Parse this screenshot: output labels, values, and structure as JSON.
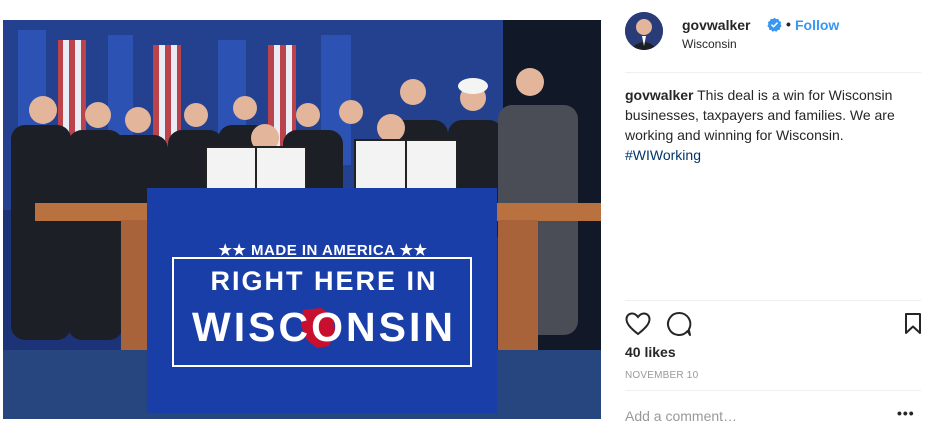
{
  "post": {
    "username": "govwalker",
    "follow_label": "Follow",
    "location": "Wisconsin",
    "caption_username": "govwalker",
    "caption_text": "This deal is a win for Wisconsin businesses, taxpayers and families. We are working and winning for Wisconsin.",
    "hashtag": "#WIWorking",
    "likes": "40 likes",
    "date": "November 10",
    "comment_placeholder": "Add a comment…",
    "more_label": "•••"
  },
  "photo": {
    "banner_line1": "★★ MADE IN AMERICA ★★",
    "banner_line2": "RIGHT HERE IN",
    "banner_line3": "WISCONSIN"
  },
  "colors": {
    "banner_blue": "#1a3ea8",
    "wisconsin_red": "#c8102e",
    "follow_blue": "#3897f0",
    "hashtag_blue": "#003569"
  },
  "icons": [
    "verified-badge-icon",
    "heart-icon",
    "comment-icon",
    "bookmark-icon"
  ]
}
